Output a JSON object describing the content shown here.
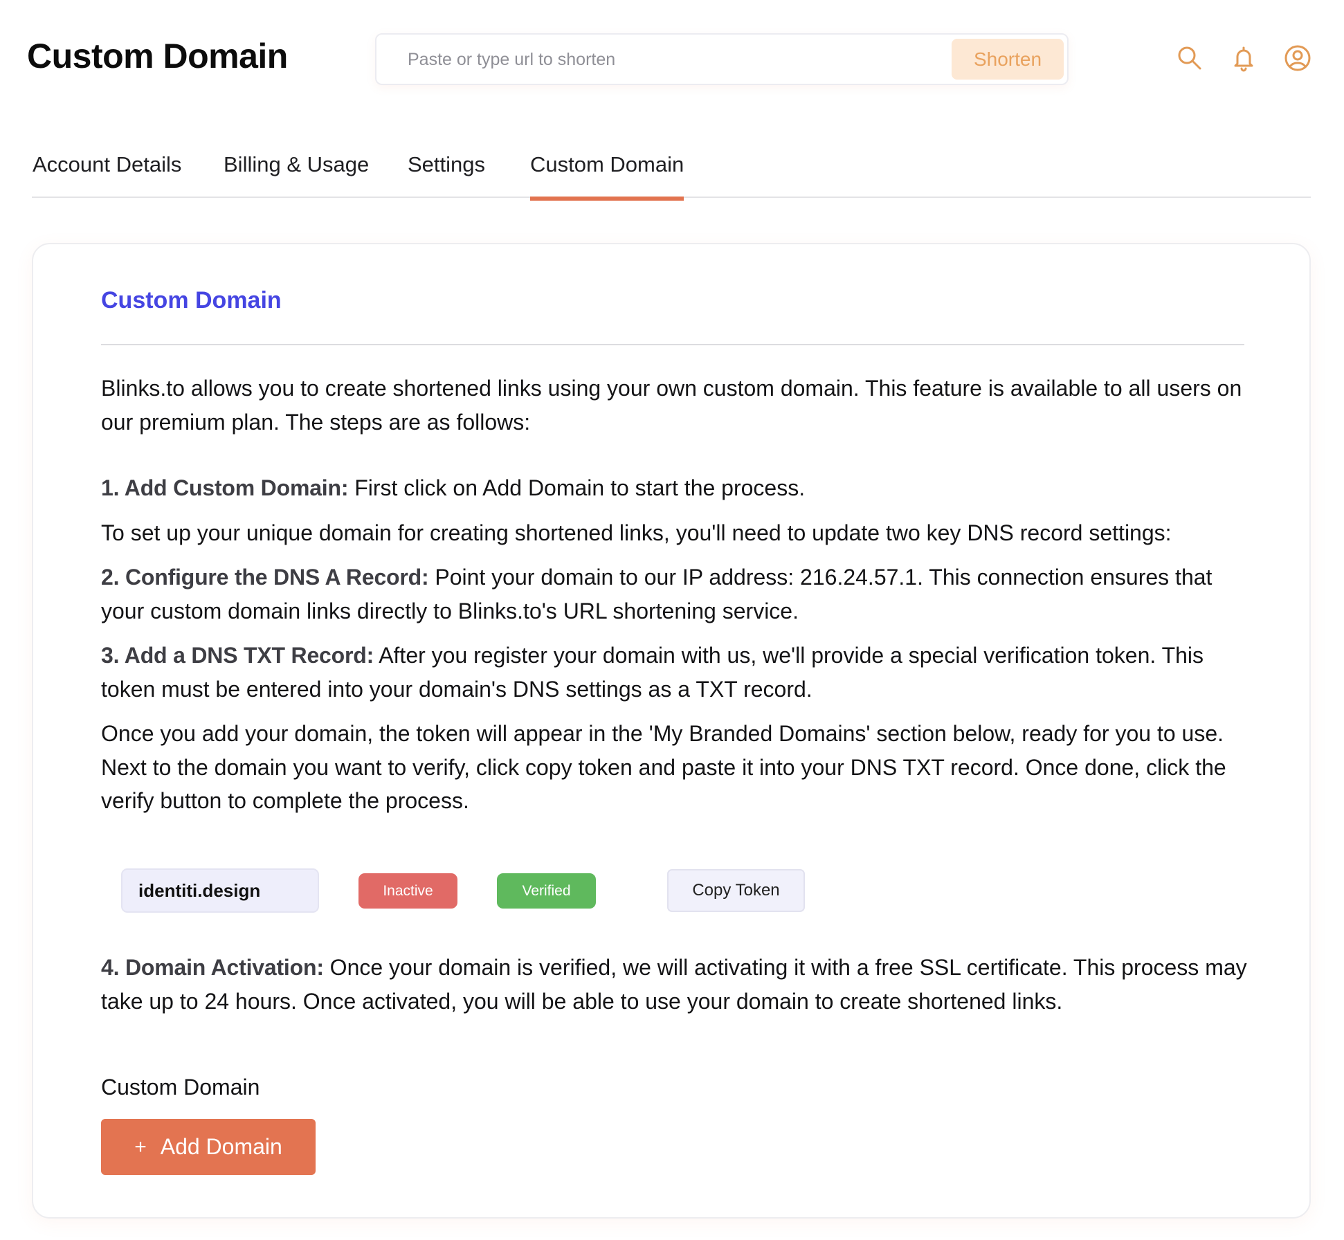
{
  "header": {
    "title": "Custom Domain",
    "search": {
      "placeholder": "Paste or type url to shorten",
      "value": ""
    },
    "shorten_label": "Shorten",
    "icons": [
      "search-icon",
      "bell-icon",
      "user-circle-icon"
    ]
  },
  "tabs": [
    {
      "label": "Account Details",
      "active": false
    },
    {
      "label": "Billing & Usage",
      "active": false
    },
    {
      "label": "Settings",
      "active": false
    },
    {
      "label": "Custom Domain",
      "active": true
    }
  ],
  "card": {
    "title": "Custom Domain",
    "intro": "Blinks.to allows you to create shortened links using your own custom domain. This feature is available to all users on our premium plan. The steps are as follows:",
    "step1": {
      "heading": "1. Add Custom Domain:",
      "text": " First click on Add Domain to start the process."
    },
    "dns_intro": "To set up your unique domain for creating shortened links, you'll need to update two key DNS record settings:",
    "step2": {
      "heading": "2. Configure the DNS A Record:",
      "text": " Point your domain to our IP address: 216.24.57.1. This connection ensures that your custom domain links directly to Blinks.to's URL shortening service."
    },
    "step3": {
      "heading": "3. Add a DNS TXT Record:",
      "text": " After you register your domain with us, we'll provide a special verification token. This token must be entered into your domain's DNS settings as a TXT record."
    },
    "token_info": "Once you add your domain, the token will appear in the 'My Branded Domains' section below, ready for you to use. Next to the domain you want to verify, click copy token and paste it into your DNS TXT record. Once done, click the verify button to complete the process.",
    "example": {
      "domain": "identiti.design",
      "status_inactive": "Inactive",
      "status_verified": "Verified",
      "copy_token_label": "Copy Token"
    },
    "step4": {
      "heading": "4. Domain Activation:",
      "text": " Once your domain is verified, we will activating it with a free SSL certificate. This process may take up to 24 hours. Once activated, you will be able to use your domain to create shortened links."
    },
    "field_label": "Custom Domain",
    "add_domain": {
      "icon": "+",
      "label": "Add Domain"
    }
  },
  "colors": {
    "accent": "#e37451",
    "card_title": "#4545e2",
    "shorten_bg": "#fde8d4",
    "shorten_text": "#e9a25e",
    "icon": "#e29a55",
    "inactive": "#e16a66",
    "verified": "#5fb95d"
  }
}
